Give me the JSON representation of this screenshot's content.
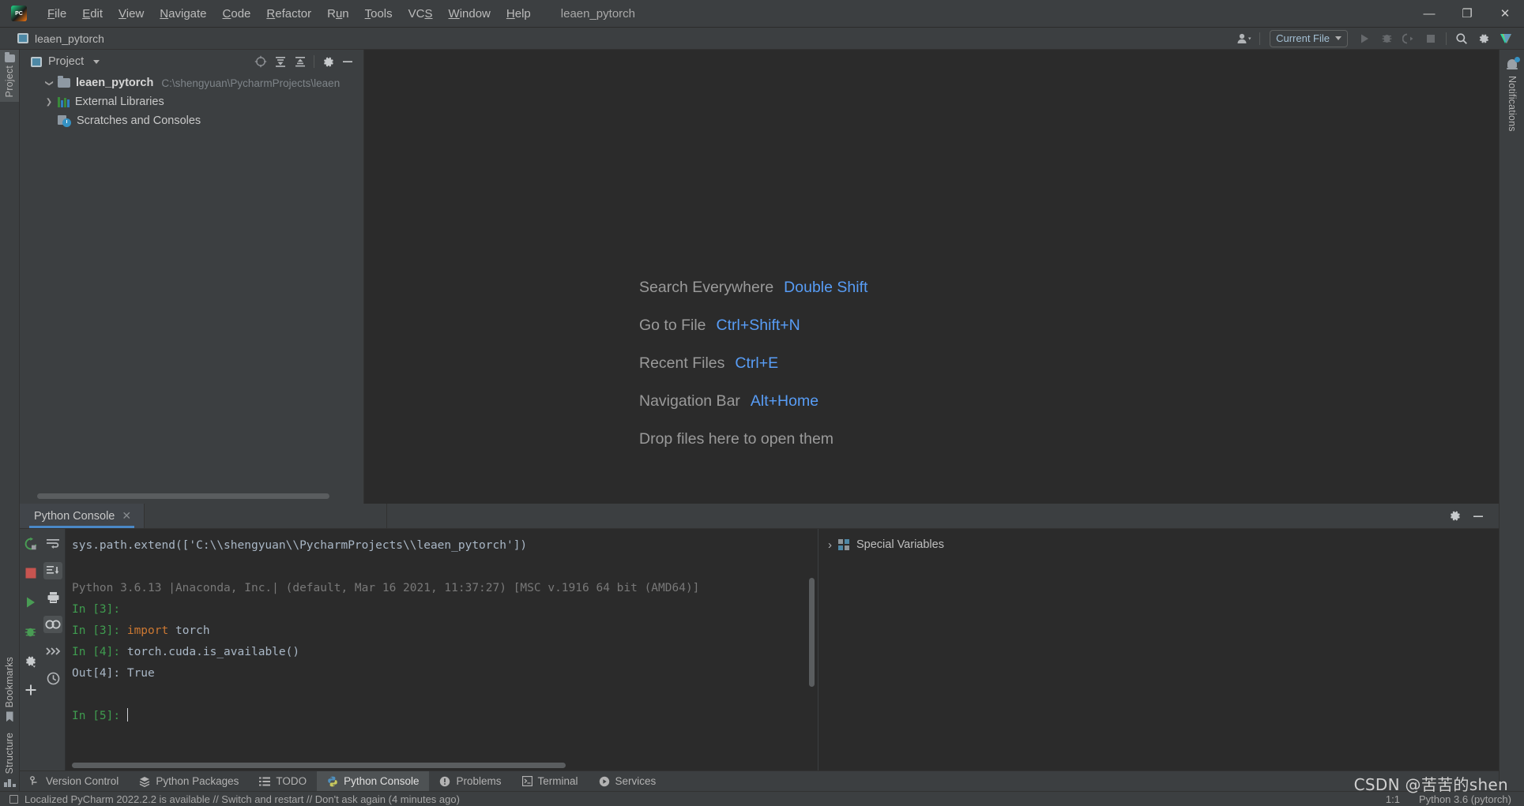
{
  "window": {
    "title": "leaen_pytorch",
    "logo_text": "PC",
    "controls": {
      "minimize": "—",
      "maximize": "❐",
      "close": "✕"
    }
  },
  "menu": [
    {
      "pre": "",
      "mnemonic": "F",
      "post": "ile"
    },
    {
      "pre": "",
      "mnemonic": "E",
      "post": "dit"
    },
    {
      "pre": "",
      "mnemonic": "V",
      "post": "iew"
    },
    {
      "pre": "",
      "mnemonic": "N",
      "post": "avigate"
    },
    {
      "pre": "",
      "mnemonic": "C",
      "post": "ode"
    },
    {
      "pre": "",
      "mnemonic": "R",
      "post": "efactor"
    },
    {
      "pre": "R",
      "mnemonic": "u",
      "post": "n"
    },
    {
      "pre": "",
      "mnemonic": "T",
      "post": "ools"
    },
    {
      "pre": "VC",
      "mnemonic": "S",
      "post": ""
    },
    {
      "pre": "",
      "mnemonic": "W",
      "post": "indow"
    },
    {
      "pre": "",
      "mnemonic": "H",
      "post": "elp"
    }
  ],
  "navbar": {
    "breadcrumb": "leaen_pytorch",
    "run_config": "Current File",
    "icons": [
      "account-icon",
      "run-icon",
      "debug-icon",
      "run-coverage-icon",
      "stop-icon",
      "search-icon",
      "settings-icon",
      "ai-assistant-icon"
    ]
  },
  "left_stripe": {
    "project_label": "Project",
    "bookmarks_label": "Bookmarks",
    "structure_label": "Structure"
  },
  "right_stripe": {
    "notifications_label": "Notifications"
  },
  "project_panel": {
    "title": "Project",
    "actions": [
      "locate-icon",
      "expand-all-icon",
      "collapse-all-icon",
      "settings-icon",
      "hide-icon"
    ],
    "tree": [
      {
        "label": "leaen_pytorch",
        "path": "C:\\shengyuan\\PycharmProjects\\leaen",
        "icon": "folder-icon",
        "arrow": "open",
        "bold": true,
        "indent": 30
      },
      {
        "label": "External Libraries",
        "path": "",
        "icon": "library-icon",
        "arrow": "closed",
        "bold": false,
        "indent": 30
      },
      {
        "label": "Scratches and Consoles",
        "path": "",
        "icon": "scratches-icon",
        "arrow": "none",
        "bold": false,
        "indent": 44
      }
    ]
  },
  "editor": {
    "shortcuts": [
      {
        "name": "Search Everywhere",
        "key": "Double Shift"
      },
      {
        "name": "Go to File",
        "key": "Ctrl+Shift+N"
      },
      {
        "name": "Recent Files",
        "key": "Ctrl+E"
      },
      {
        "name": "Navigation Bar",
        "key": "Alt+Home"
      }
    ],
    "drop_hint": "Drop files here to open them"
  },
  "console": {
    "tab_label": "Python Console",
    "tab_close": "✕",
    "actions": [
      "settings-icon",
      "hide-icon"
    ],
    "gutter_left": [
      "rerun-icon",
      "stop-icon",
      "execute-icon",
      "debug-icon",
      "settings-icon",
      "new-console-icon"
    ],
    "gutter_right": [
      "soft-wrap-icon",
      "scroll-end-icon",
      "print-icon",
      "show-variables-icon",
      "show-prompt-icon",
      "history-icon"
    ],
    "lines": [
      {
        "style": "white",
        "text": "sys.path.extend(['C:\\\\shengyuan\\\\PycharmProjects\\\\leaen_pytorch'])"
      },
      {
        "style": "blank",
        "text": ""
      },
      {
        "style": "gray",
        "text": "Python 3.6.13 |Anaconda, Inc.| (default, Mar 16 2021, 11:37:27) [MSC v.1916 64 bit (AMD64)]"
      },
      {
        "style": "prompt",
        "prompt": "In [3]: ",
        "code": "",
        "code_style": "white"
      },
      {
        "style": "prompt",
        "prompt": "In [3]: ",
        "code": "import torch",
        "code_style": "orange-kw"
      },
      {
        "style": "prompt",
        "prompt": "In [4]: ",
        "code": "torch.cuda.is_available()",
        "code_style": "white"
      },
      {
        "style": "out",
        "prompt": "Out[4]: ",
        "code": "True",
        "code_style": "white"
      },
      {
        "style": "blank",
        "text": ""
      },
      {
        "style": "prompt-caret",
        "prompt": "In [5]: ",
        "code": "",
        "code_style": "white"
      }
    ],
    "variables_title": "Special Variables",
    "variables_arrow": "›"
  },
  "bottom_tabs": [
    {
      "label": "Version Control",
      "icon": "branch-icon",
      "active": false
    },
    {
      "label": "Python Packages",
      "icon": "packages-icon",
      "active": false
    },
    {
      "label": "TODO",
      "icon": "todo-icon",
      "active": false
    },
    {
      "label": "Python Console",
      "icon": "python-icon",
      "active": true
    },
    {
      "label": "Problems",
      "icon": "problems-icon",
      "active": false
    },
    {
      "label": "Terminal",
      "icon": "terminal-icon",
      "active": false
    },
    {
      "label": "Services",
      "icon": "services-icon",
      "active": false
    }
  ],
  "statusbar": {
    "message": "Localized PyCharm 2022.2.2 is available // Switch and restart // Don't ask again (4 minutes ago)",
    "caret_position": "1:1",
    "interpreter": "Python 3.6 (pytorch)"
  },
  "watermark": "CSDN @苦苦的shen",
  "colors": {
    "accent_blue": "#589df6",
    "tab_underline": "#4a88c7",
    "console_bg": "#2b2b2b",
    "chrome_bg": "#3c3f41",
    "prompt_green": "#3f9c4f",
    "keyword_orange": "#cc7832"
  }
}
